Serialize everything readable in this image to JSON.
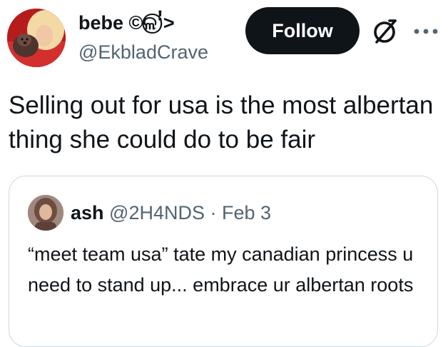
{
  "author": {
    "display_name": "bebe ©ଳ⃝ꜝ>",
    "handle": "@EkbladCrave",
    "avatar_icon": "user-avatar-with-dog"
  },
  "actions": {
    "follow_label": "Follow",
    "grok_icon": "grok-icon",
    "more_icon": "more-options-icon"
  },
  "tweet": {
    "text": "Selling out for usa is the most albertan thing she could do to be fair"
  },
  "quoted": {
    "name": "ash",
    "handle": "@2H4NDS",
    "separator": "·",
    "date": "Feb 3",
    "text": "“meet team usa” tate my canadian princess u need to stand up... embrace ur albertan roots"
  },
  "colors": {
    "text": "#0f1419",
    "secondary": "#536471",
    "border": "#cfd9de",
    "follow_bg": "#0f1419"
  }
}
